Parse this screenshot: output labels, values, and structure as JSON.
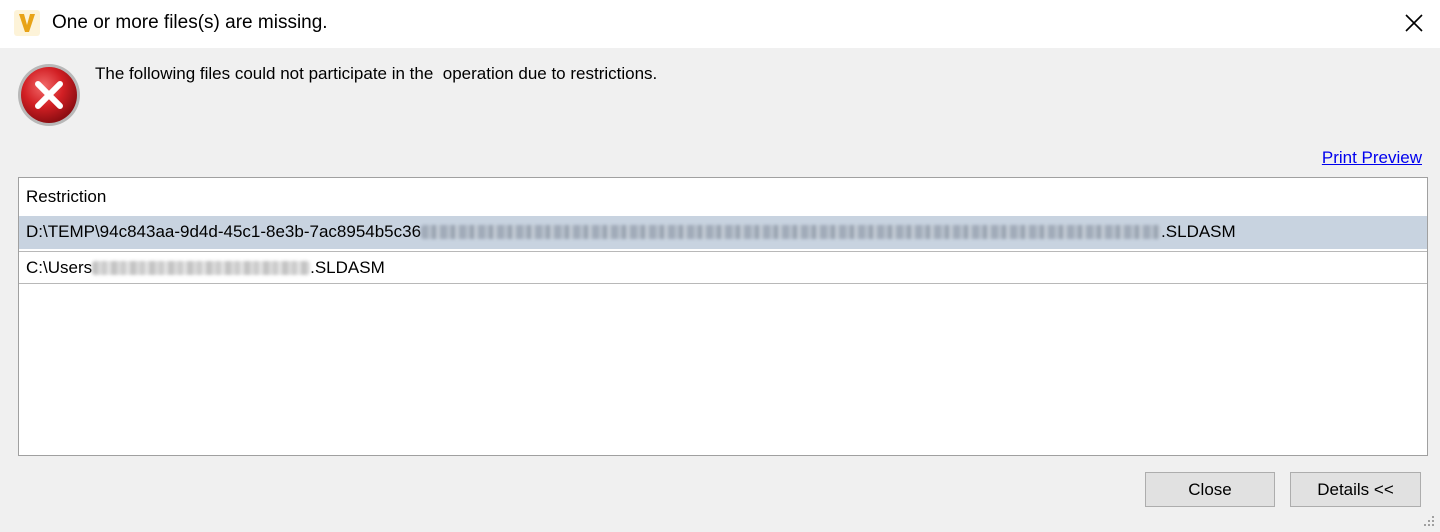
{
  "window": {
    "title": "One or more files(s) are missing.",
    "app_icon_letter": "V",
    "app_icon_color": "#e8a317"
  },
  "message": {
    "text": "The following files could not participate in the  operation due to restrictions.",
    "icon": "error-icon",
    "icon_color": "#c8181d"
  },
  "links": {
    "print_preview": "Print Preview"
  },
  "list": {
    "header": "Restriction",
    "rows": [
      {
        "prefix": "D:\\TEMP\\94c843aa-9d4d-45c1-8e3b-7ac8954b5c36",
        "suffix": ".SLDASM",
        "selected": true
      },
      {
        "prefix": "C:\\Users",
        "suffix": ".SLDASM",
        "selected": false
      }
    ]
  },
  "buttons": {
    "close": "Close",
    "details": "Details <<"
  },
  "colors": {
    "selection": "#c8d3e0",
    "link": "#0000ee",
    "dialog_bg": "#f0f0f0"
  }
}
